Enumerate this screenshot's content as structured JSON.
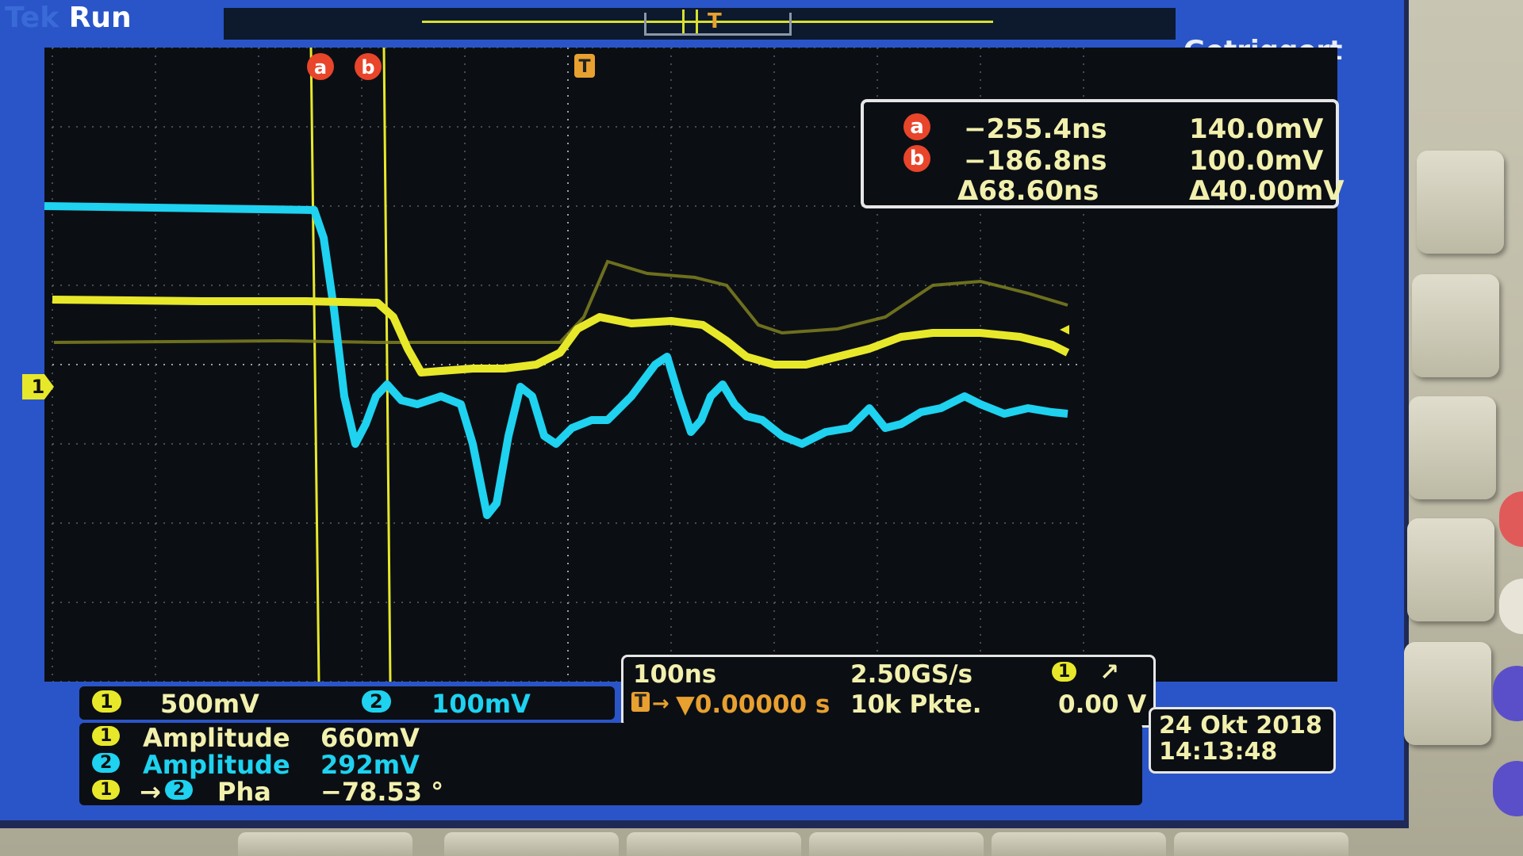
{
  "header": {
    "brand": "Tek",
    "mode": "Run",
    "trigger_status": "Getriggert"
  },
  "markers": {
    "cursor_a": "a",
    "cursor_b": "b",
    "trigger": "T",
    "channel1_ground": "1"
  },
  "cursors": {
    "a": {
      "id": "a",
      "time": "−255.4ns",
      "voltage": "140.0mV"
    },
    "b": {
      "id": "b",
      "time": "−186.8ns",
      "voltage": "100.0mV"
    },
    "delta": {
      "time": "Δ68.60ns",
      "voltage": "Δ40.00mV"
    }
  },
  "channels": {
    "ch1": {
      "id": "1",
      "scale": "500mV",
      "color": "#e8e82a"
    },
    "ch2": {
      "id": "2",
      "scale": "100mV",
      "color": "#1ed2f0"
    }
  },
  "timebase": {
    "time_per_div": "100ns",
    "sample_rate": "2.50GS/s",
    "trigger_position": "▼0.00000 s",
    "record_length": "10k Pkte.",
    "trigger_source": "1",
    "trigger_slope": "↗",
    "trigger_level": "0.00 V"
  },
  "measurements": [
    {
      "label": "Amplitude",
      "value": "660mV"
    },
    {
      "label": "Amplitude",
      "value": "292mV"
    },
    {
      "label": "Pha",
      "value": "−78.53 °"
    }
  ],
  "meas_arrow": "→",
  "date": {
    "date": "24 Okt  2018",
    "time": "14:13:48"
  },
  "colors": {
    "screen_blue": "#2a55c8",
    "ch1_yellow": "#e8e82a",
    "ch2_cyan": "#1ed2f0",
    "cursor_orange": "#e8452a",
    "trigger_orange": "#e8a030"
  }
}
